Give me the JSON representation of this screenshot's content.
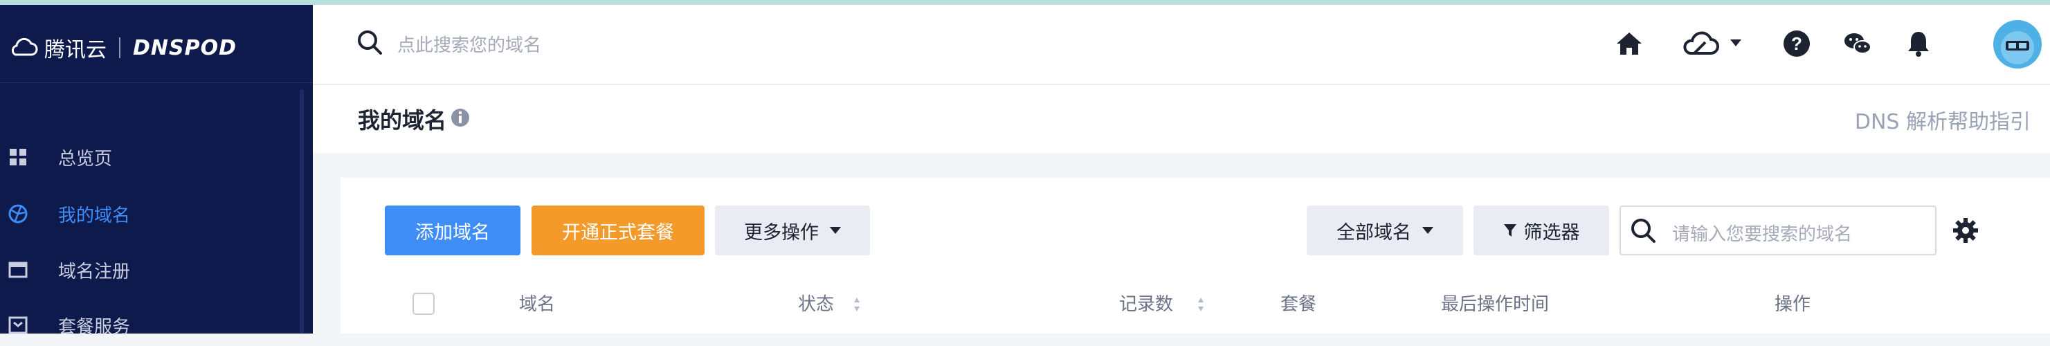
{
  "brand": {
    "cloud_name": "腾讯云",
    "product_name": "DNSPOD"
  },
  "topbar": {
    "search_placeholder": "点此搜索您的域名",
    "icons": [
      "home-icon",
      "cloud-icon",
      "help-icon",
      "wechat-icon",
      "bell-icon",
      "avatar"
    ]
  },
  "sidebar": {
    "items": [
      {
        "label": "总览页",
        "icon": "dashboard-icon",
        "active": false
      },
      {
        "label": "我的域名",
        "icon": "domain-icon",
        "active": true
      },
      {
        "label": "域名注册",
        "icon": "register-icon",
        "active": false
      },
      {
        "label": "套餐服务",
        "icon": "package-icon",
        "active": false
      }
    ]
  },
  "page": {
    "title": "我的域名",
    "help_link": "DNS 解析帮助指引"
  },
  "toolbar": {
    "add_domain": "添加域名",
    "open_plan": "开通正式套餐",
    "more_actions": "更多操作",
    "all_domains": "全部域名",
    "filter": "筛选器",
    "search_placeholder": "请输入您要搜索的域名"
  },
  "table": {
    "columns": [
      "域名",
      "状态",
      "记录数",
      "套餐",
      "最后操作时间",
      "操作"
    ]
  },
  "colors": {
    "sidebar_bg": "#0e1a4c",
    "accent": "#3f8df6",
    "orange": "#f39a2b"
  }
}
